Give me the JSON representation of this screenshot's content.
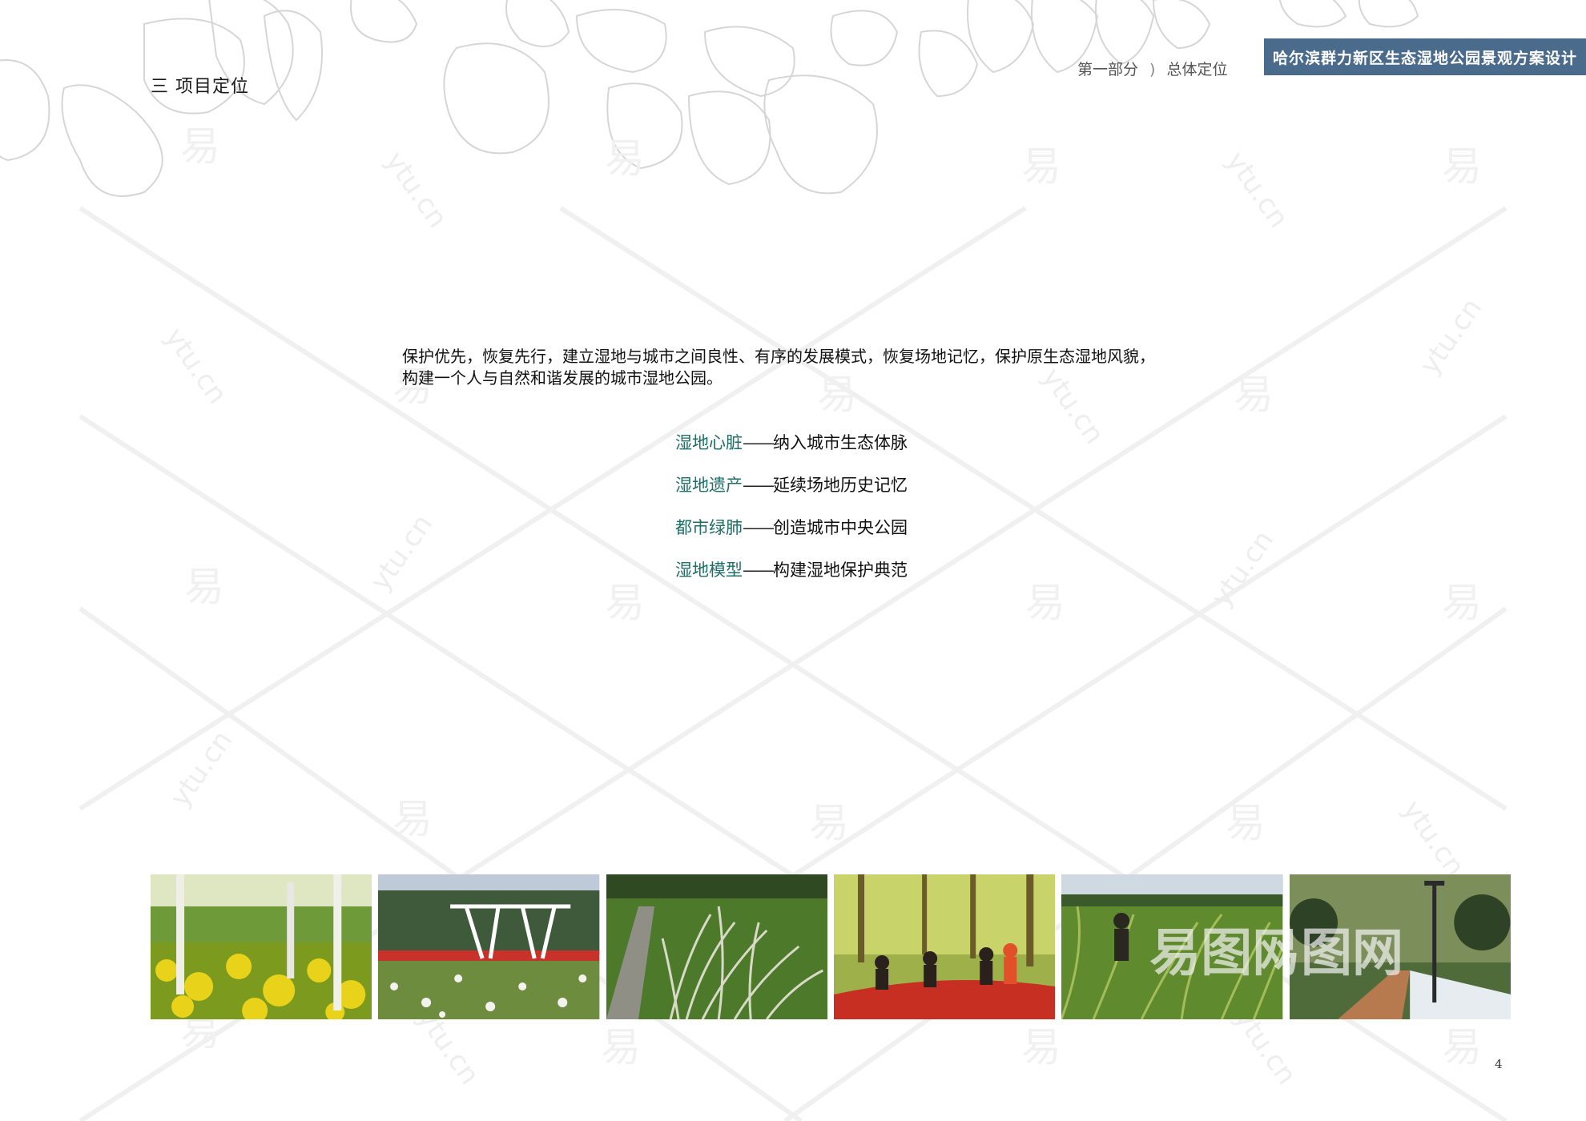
{
  "section": {
    "title": "三  项目定位"
  },
  "header": {
    "part": "第一部分",
    "chapter": "总体定位",
    "project_title": "哈尔滨群力新区生态湿地公园景观方案设计"
  },
  "intro": {
    "line1": "保护优先，恢复先行，建立湿地与城市之间良性、有序的发展模式，恢复场地记忆，保护原生态湿地风貌，",
    "line2": "构建一个人与自然和谐发展的城市湿地公园。"
  },
  "objectives": [
    {
      "key": "湿地心脏",
      "dash": "——",
      "desc": "纳入城市生态体脉"
    },
    {
      "key": "湿地遗产",
      "dash": "——",
      "desc": "延续场地历史记忆"
    },
    {
      "key": "都市绿肺",
      "dash": "——",
      "desc": "创造城市中央公园"
    },
    {
      "key": "湿地模型",
      "dash": "——",
      "desc": "构建湿地保护典范"
    }
  ],
  "photos": [
    {
      "subject": "yellow-flower-meadow-with-trees"
    },
    {
      "subject": "white-canopy-structure-and-wildflowers"
    },
    {
      "subject": "tall-grass-and-stone-path"
    },
    {
      "subject": "people-seated-on-red-bench-in-forest"
    },
    {
      "subject": "woman-in-tall-reed-grass"
    },
    {
      "subject": "wooden-boardwalk-with-lamp-post"
    }
  ],
  "watermark": {
    "glyph": "易",
    "domain": "ytu.cn",
    "logo": "易图网"
  },
  "page_number": "4",
  "colors": {
    "banner": "#4a6b8c",
    "objective_key": "#1f6e67"
  }
}
